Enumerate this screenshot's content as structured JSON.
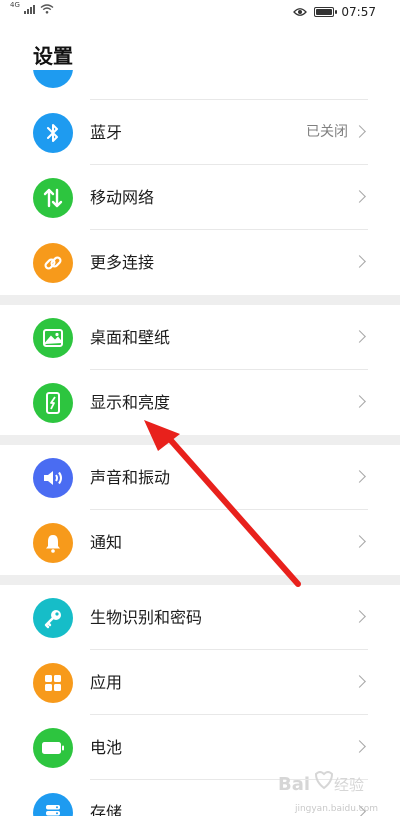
{
  "status_bar": {
    "time": "07:57",
    "network": "4G",
    "battery_level": 0.85
  },
  "header": {
    "title": "设置"
  },
  "groups": [
    {
      "items": [
        {
          "label": "",
          "icon": "unknown-icon",
          "color": "#1E9BF0",
          "partial": true
        },
        {
          "label": "蓝牙",
          "value": "已关闭",
          "icon": "bluetooth-icon",
          "color": "#1E9BF0"
        },
        {
          "label": "移动网络",
          "icon": "mobile-data-icon",
          "color": "#2DC53F"
        },
        {
          "label": "更多连接",
          "icon": "link-icon",
          "color": "#F79A1B"
        }
      ]
    },
    {
      "items": [
        {
          "label": "桌面和壁纸",
          "icon": "wallpaper-icon",
          "color": "#2DC53F"
        },
        {
          "label": "显示和亮度",
          "icon": "display-brightness-icon",
          "color": "#2DC53F"
        }
      ]
    },
    {
      "items": [
        {
          "label": "声音和振动",
          "icon": "speaker-icon",
          "color": "#4A6CF2"
        },
        {
          "label": "通知",
          "icon": "bell-icon",
          "color": "#F79A1B"
        }
      ]
    },
    {
      "items": [
        {
          "label": "生物识别和密码",
          "icon": "key-icon",
          "color": "#16BDC8"
        },
        {
          "label": "应用",
          "icon": "apps-grid-icon",
          "color": "#F79A1B"
        },
        {
          "label": "电池",
          "icon": "battery-icon",
          "color": "#2DC53F"
        },
        {
          "label": "存储",
          "icon": "storage-icon",
          "color": "#1E9BF0"
        }
      ]
    }
  ],
  "watermark": {
    "brand": "Baidu经验",
    "url": "jingyan.baidu.com"
  }
}
